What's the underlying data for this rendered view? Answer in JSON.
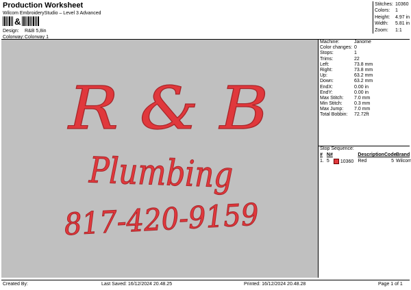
{
  "header": {
    "title": "Production Worksheet",
    "subtitle": "Wilcom EmbroideryStudio – Level 3 Advanced",
    "design_label": "Design:",
    "design_value": "R&B 5,8in",
    "colorway_label": "Colorway:",
    "colorway_value": "Colorway 1"
  },
  "stats": [
    {
      "label": "Stitches:",
      "value": "10360"
    },
    {
      "label": "Colors:",
      "value": "1"
    },
    {
      "label": "Height:",
      "value": "4.97 in"
    },
    {
      "label": "Width:",
      "value": "5.81 in"
    },
    {
      "label": "Zoom:",
      "value": "1:1"
    }
  ],
  "design_text": {
    "line1": "R & B",
    "line2": "Plumbing",
    "line3": "817-420-9159"
  },
  "machine_info": [
    {
      "label": "Machine:",
      "value": "Janome"
    },
    {
      "label": "Color changes:",
      "value": "0"
    },
    {
      "label": "Stops:",
      "value": "1"
    },
    {
      "label": "Trims:",
      "value": "22"
    },
    {
      "label": "Left:",
      "value": "73.8 mm"
    },
    {
      "label": "Right:",
      "value": "73.8 mm"
    },
    {
      "label": "Up:",
      "value": "63.2 mm"
    },
    {
      "label": "Down:",
      "value": "63.2 mm"
    },
    {
      "label": "EndX:",
      "value": "0.00 in"
    },
    {
      "label": "EndY:",
      "value": "0.00 in"
    },
    {
      "label": "Max Stitch:",
      "value": "7.0 mm"
    },
    {
      "label": "Min Stitch:",
      "value": "0.3 mm"
    },
    {
      "label": "Max Jump:",
      "value": "7.0 mm"
    },
    {
      "label": "Total Bobbin:",
      "value": "72.72ft"
    }
  ],
  "stop_sequence": {
    "title": "Stop Sequence:",
    "headers": [
      "#",
      "N#",
      "",
      "Description",
      "Code",
      "Brand"
    ],
    "rows": [
      {
        "idx": "1.",
        "n": "5",
        "stitches": "10360",
        "description": "Red",
        "code": "5",
        "brand": "Wilcom",
        "color": "#e0383c"
      }
    ]
  },
  "footer": {
    "created_by": "Created By:",
    "last_saved": "Last Saved: 16/12/2024 20.48.25",
    "printed": "Printed: 16/12/2024 20.48.28",
    "page": "Page 1 of 1"
  },
  "colors": {
    "thread": "#e0383c",
    "thread_shadow": "#a8262a",
    "preview_bg": "#c0c0c0"
  }
}
